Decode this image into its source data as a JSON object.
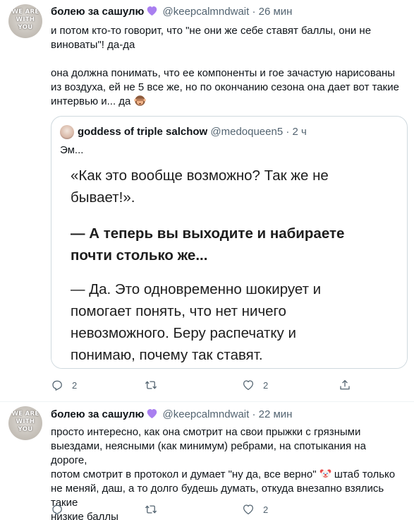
{
  "tweets": [
    {
      "author": "болею за сашулю",
      "handle": "@keepcalmndwait",
      "separator": "·",
      "time": "26 мин",
      "avatar_text": "WE ARE WITH YOU",
      "paragraph1": "и потом кто-то говорит, что \"не они же себе ставят баллы, они не\nвиноваты\"! да-да",
      "paragraph2": "она должна понимать, что ее компоненты и гое зачастую нарисованы\nиз воздуха, ей не 5 все же, но по окончанию сезона она дает вот такие\nинтервью и... да",
      "paragraph2_emoji": "see-no-evil-monkey-icon",
      "quote": {
        "author": "goddess of triple salchow",
        "handle": "@medoqueen5",
        "separator": "·",
        "time": "2 ч",
        "text": "Эм...",
        "image_paragraphs": [
          {
            "text": "«Как это вообще возможно? Так же не\nбывает!».",
            "bold": false
          },
          {
            "text": "— А теперь вы выходите и набираете\nпочти столько же...",
            "bold": true
          },
          {
            "text": "— Да. Это одновременно шокирует и\nпомогает понять, что нет ничего\nневозможного. Беру распечатку и\nпонимаю, почему так ставят.",
            "bold": false
          }
        ]
      },
      "actions": {
        "reply_count": "2",
        "retweet_count": "",
        "like_count": "2"
      }
    },
    {
      "author": "болею за сашулю",
      "handle": "@keepcalmndwait",
      "separator": "·",
      "time": "22 мин",
      "avatar_text": "WE ARE WITH YOU",
      "text_before_emoji": "просто интересно, как она смотрит на свои прыжки с грязными\nвыездами, неясными (как минимум) ребрами, на спотыкания на дороге,\nпотом смотрит в протокол и думает \"ну да, все верно\" ",
      "emoji": "clown-face-icon",
      "text_after_emoji": " штаб только\nне меняй, даш, а то долго будешь думать, откуда внезапно взялись такие\nнизкие баллы",
      "actions": {
        "reply_count": "",
        "retweet_count": "",
        "like_count": "2"
      }
    }
  ],
  "colors": {
    "text": "#0f1419",
    "secondary": "#536471",
    "border": "#cfd9de",
    "heart": "#a97ff0"
  }
}
